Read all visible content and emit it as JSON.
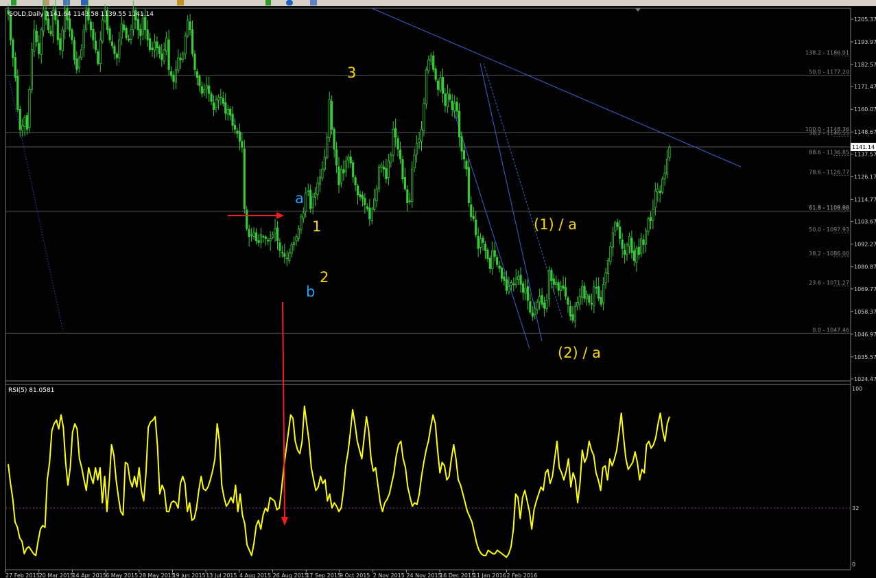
{
  "toolbar": {
    "icons": [
      "new-chart-icon",
      "profiles-icon",
      "navigator-icon",
      "crosshair-icon",
      "line-tool-icon",
      "add-indicator-icon",
      "period-icon",
      "chart-bar-icon"
    ]
  },
  "chart_data": [
    {
      "type": "candlestick",
      "header": "GOLD,Daily  1141.64 1143.58 1139.55 1141.14",
      "symbol": "GOLD",
      "timeframe": "Daily",
      "ohlc_last": [
        1141.64,
        1143.58,
        1139.55,
        1141.14
      ],
      "current_price_label": "1141.14",
      "ylim": [
        1024.47,
        1210.0
      ],
      "y_ticks": [
        "1205.37",
        "1193.97",
        "1182.57",
        "1171.47",
        "1160.07",
        "1148.67",
        "1137.57",
        "1126.17",
        "1114.77",
        "1103.67",
        "1092.27",
        "1080.87",
        "1069.77",
        "1058.37",
        "1046.97",
        "1035.57",
        "1024.47"
      ],
      "x_ticks": [
        "27 Feb 2015",
        "20 Mar 2015",
        "14 Apr 2015",
        "6 May 2015",
        "28 May 2015",
        "19 Jun 2015",
        "13 Jul 2015",
        "4 Aug 2015",
        "26 Aug 2015",
        "17 Sep 2015",
        "9 Oct 2015",
        "2 Nov 2015",
        "24 Nov 2015",
        "16 Dec 2015",
        "11 Jan 2016",
        "2 Feb 2016"
      ],
      "fib_levels": [
        {
          "label": "138.2 - 1186.91",
          "value": 1186.91
        },
        {
          "label": "50.0 - 1177.20",
          "value": 1177.2
        },
        {
          "label": "100.0 - 1148.36",
          "value": 1148.36
        },
        {
          "label": "38.2 - 1146.55",
          "value": 1146.55
        },
        {
          "label": "88.6 - 1136.85",
          "value": 1136.85
        },
        {
          "label": "78.6 - 1126.77",
          "value": 1126.77
        },
        {
          "label": "61.8 - 1109.00",
          "value": 1109.0
        },
        {
          "label": "61.8 - 1108.88",
          "value": 1108.88
        },
        {
          "label": "50.0 - 1097.93",
          "value": 1097.93
        },
        {
          "label": "38.2 - 1086.00",
          "value": 1086.0
        },
        {
          "label": "23.6 - 1071.27",
          "value": 1071.27
        },
        {
          "label": "0.0 - 1047.46",
          "value": 1047.46
        }
      ],
      "horizontal_lines": [
        1177.2,
        1148.36,
        1141.14,
        1108.88,
        1047.46
      ],
      "wave_labels": [
        {
          "text": "a",
          "color": "#1ea5ff"
        },
        {
          "text": "1",
          "color": "#ffd700"
        },
        {
          "text": "2",
          "color": "#ffd700"
        },
        {
          "text": "b",
          "color": "#1ea5ff"
        },
        {
          "text": "3",
          "color": "#ffd700"
        },
        {
          "text": "(1) / a",
          "color": "#ffd700"
        },
        {
          "text": "(2) / a",
          "color": "#ffd700"
        }
      ],
      "closes": [
        1208,
        1195,
        1186,
        1176,
        1160,
        1150,
        1152,
        1156,
        1150,
        1170,
        1190,
        1200,
        1194,
        1188,
        1200,
        1210,
        1205,
        1200,
        1198,
        1210,
        1205,
        1195,
        1190,
        1200,
        1210,
        1205,
        1200,
        1195,
        1185,
        1180,
        1186,
        1190,
        1200,
        1210,
        1205,
        1200,
        1195,
        1190,
        1183,
        1195,
        1205,
        1210,
        1200,
        1195,
        1192,
        1188,
        1186,
        1195,
        1203,
        1200,
        1196,
        1195,
        1200,
        1210,
        1205,
        1200,
        1197,
        1206,
        1200,
        1195,
        1190,
        1190,
        1194,
        1191,
        1188,
        1185,
        1190,
        1196,
        1180,
        1177,
        1174,
        1180,
        1186,
        1185,
        1188,
        1197,
        1205,
        1200,
        1188,
        1180,
        1176,
        1172,
        1168,
        1170,
        1172,
        1168,
        1164,
        1160,
        1165,
        1166,
        1166,
        1163,
        1158,
        1160,
        1157,
        1152,
        1150,
        1148,
        1144,
        1141,
        1110,
        1100,
        1096,
        1097,
        1098,
        1094,
        1093,
        1097,
        1096,
        1095,
        1094,
        1095,
        1097,
        1100,
        1094,
        1089,
        1088,
        1086,
        1085,
        1088,
        1092,
        1093,
        1096,
        1100,
        1106,
        1108,
        1118,
        1119,
        1110,
        1116,
        1118,
        1123,
        1126,
        1130,
        1136,
        1146,
        1165,
        1150,
        1140,
        1132,
        1122,
        1130,
        1128,
        1134,
        1136,
        1133,
        1126,
        1122,
        1117,
        1116,
        1115,
        1112,
        1110,
        1105,
        1110,
        1115,
        1120,
        1131,
        1132,
        1130,
        1125,
        1134,
        1137,
        1150,
        1146,
        1140,
        1135,
        1125,
        1120,
        1113,
        1114,
        1130,
        1137,
        1143,
        1145,
        1150,
        1163,
        1180,
        1185,
        1187,
        1180,
        1175,
        1170,
        1176,
        1168,
        1162,
        1168,
        1165,
        1160,
        1163,
        1159,
        1146,
        1139,
        1135,
        1130,
        1113,
        1106,
        1105,
        1097,
        1090,
        1095,
        1093,
        1089,
        1085,
        1080,
        1089,
        1086,
        1082,
        1080,
        1075,
        1074,
        1069,
        1071,
        1073,
        1072,
        1075,
        1076,
        1072,
        1068,
        1070,
        1064,
        1058,
        1056,
        1060,
        1063,
        1066,
        1062,
        1060,
        1064,
        1079,
        1074,
        1072,
        1073,
        1069,
        1071,
        1070,
        1066,
        1062,
        1056,
        1054,
        1061,
        1063,
        1066,
        1071,
        1065,
        1067,
        1063,
        1062,
        1071,
        1070,
        1065,
        1062,
        1072,
        1078,
        1084,
        1091,
        1098,
        1103,
        1101,
        1095,
        1090,
        1087,
        1092,
        1096,
        1088,
        1084,
        1090,
        1087,
        1095,
        1092,
        1099,
        1105,
        1104,
        1110,
        1119,
        1120,
        1118,
        1125,
        1128,
        1135,
        1141
      ]
    },
    {
      "type": "line",
      "header": "RSI(5) 81.0581",
      "indicator": "RSI(5)",
      "last_value": 81.0581,
      "ylim": [
        0,
        100
      ],
      "y_ticks": [
        "100",
        "32",
        "0"
      ],
      "reference_level": 32,
      "values": [
        57,
        46,
        37,
        24,
        21,
        15,
        13,
        6,
        9,
        10,
        8,
        6,
        5,
        13,
        20,
        22,
        21,
        48,
        58,
        76,
        80,
        82,
        77,
        85,
        78,
        58,
        45,
        55,
        75,
        80,
        77,
        60,
        55,
        48,
        42,
        55,
        50,
        46,
        55,
        48,
        55,
        35,
        50,
        30,
        47,
        68,
        62,
        48,
        38,
        30,
        28,
        58,
        57,
        48,
        44,
        50,
        44,
        55,
        42,
        36,
        52,
        78,
        81,
        82,
        84,
        67,
        40,
        45,
        42,
        30,
        30,
        35,
        36,
        35,
        32,
        46,
        50,
        46,
        30,
        35,
        25,
        26,
        32,
        42,
        50,
        43,
        42,
        44,
        48,
        53,
        60,
        80,
        70,
        45,
        38,
        33,
        35,
        38,
        35,
        45,
        30,
        40,
        28,
        23,
        11,
        8,
        5,
        12,
        22,
        25,
        20,
        28,
        32,
        30,
        38,
        37,
        36,
        31,
        32,
        42,
        55,
        65,
        75,
        85,
        83,
        70,
        65,
        63,
        70,
        90,
        80,
        70,
        55,
        48,
        42,
        44,
        50,
        46,
        48,
        36,
        40,
        32,
        35,
        33,
        30,
        32,
        42,
        56,
        64,
        75,
        88,
        80,
        70,
        65,
        60,
        72,
        84,
        76,
        60,
        53,
        55,
        45,
        35,
        30,
        35,
        37,
        40,
        46,
        52,
        62,
        68,
        70,
        60,
        55,
        44,
        38,
        33,
        35,
        34,
        40,
        50,
        58,
        65,
        70,
        78,
        85,
        80,
        65,
        52,
        58,
        56,
        48,
        50,
        60,
        68,
        60,
        48,
        45,
        40,
        35,
        30,
        27,
        24,
        18,
        12,
        8,
        6,
        5,
        5,
        8,
        7,
        6,
        6,
        8,
        7,
        6,
        5,
        4,
        6,
        10,
        20,
        40,
        38,
        26,
        38,
        42,
        36,
        30,
        20,
        31,
        36,
        40,
        44,
        42,
        52,
        54,
        46,
        50,
        60,
        70,
        55,
        52,
        48,
        53,
        60,
        44,
        52,
        48,
        35,
        46,
        65,
        58,
        61,
        70,
        65,
        62,
        52,
        48,
        42,
        55,
        56,
        48,
        60,
        56,
        60,
        65,
        75,
        86,
        72,
        60,
        54,
        56,
        58,
        64,
        58,
        48,
        54,
        52,
        68,
        70,
        66,
        68,
        72,
        80,
        86,
        76,
        70,
        80,
        84
      ]
    }
  ]
}
